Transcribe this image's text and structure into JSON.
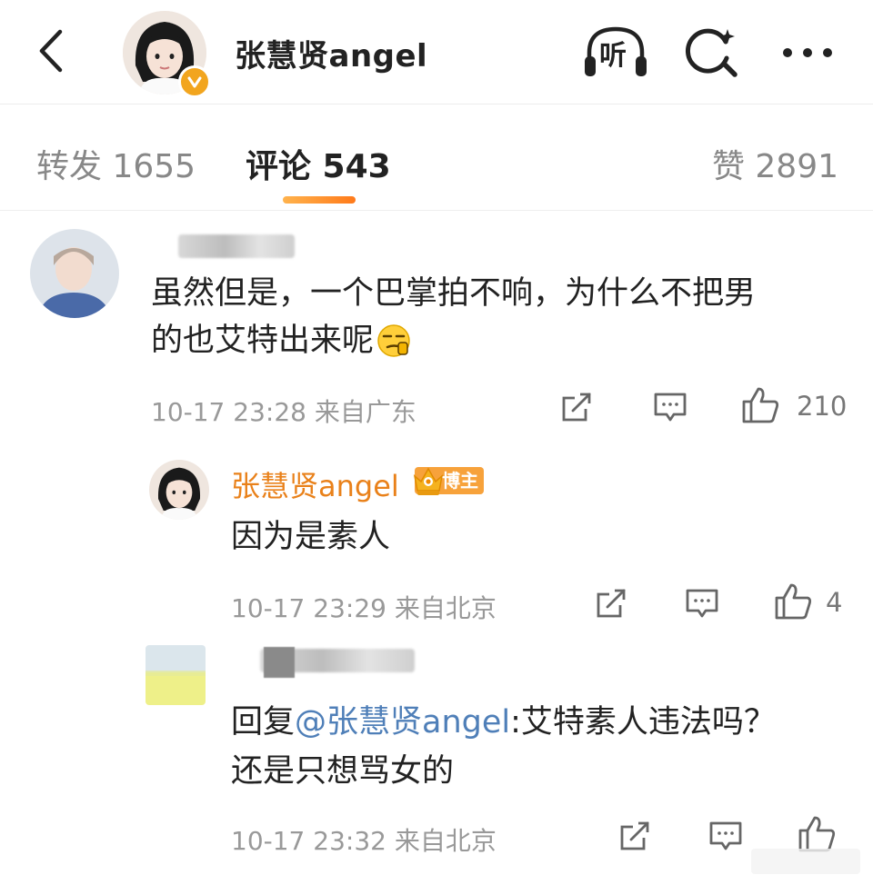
{
  "header": {
    "name": "张慧贤angel",
    "listen_label": "听"
  },
  "tabs": {
    "repost": "转发 1655",
    "comment": "评论 543",
    "like": "赞 2891"
  },
  "comments": [
    {
      "text_line1": "虽然但是，一个巴掌拍不响，为什么不把男",
      "text_line2": "的也艾特出来呢",
      "time": "10-17 23:28 来自广东",
      "likes": "210"
    },
    {
      "username": "张慧贤angel",
      "badge": "博主",
      "text": "因为是素人",
      "time": "10-17 23:29 来自北京",
      "likes": "4"
    },
    {
      "reply_prefix": "回复",
      "mention": "@张慧贤angel",
      "reply_text": ":艾特素人违法吗？",
      "text_line2": "还是只想骂女的",
      "time": "10-17 23:32 来自北京"
    }
  ],
  "colors": {
    "accent": "#ff7a1a",
    "reply_name": "#e9811a",
    "mention": "#4f7fb8",
    "verified": "#f2a51e"
  }
}
